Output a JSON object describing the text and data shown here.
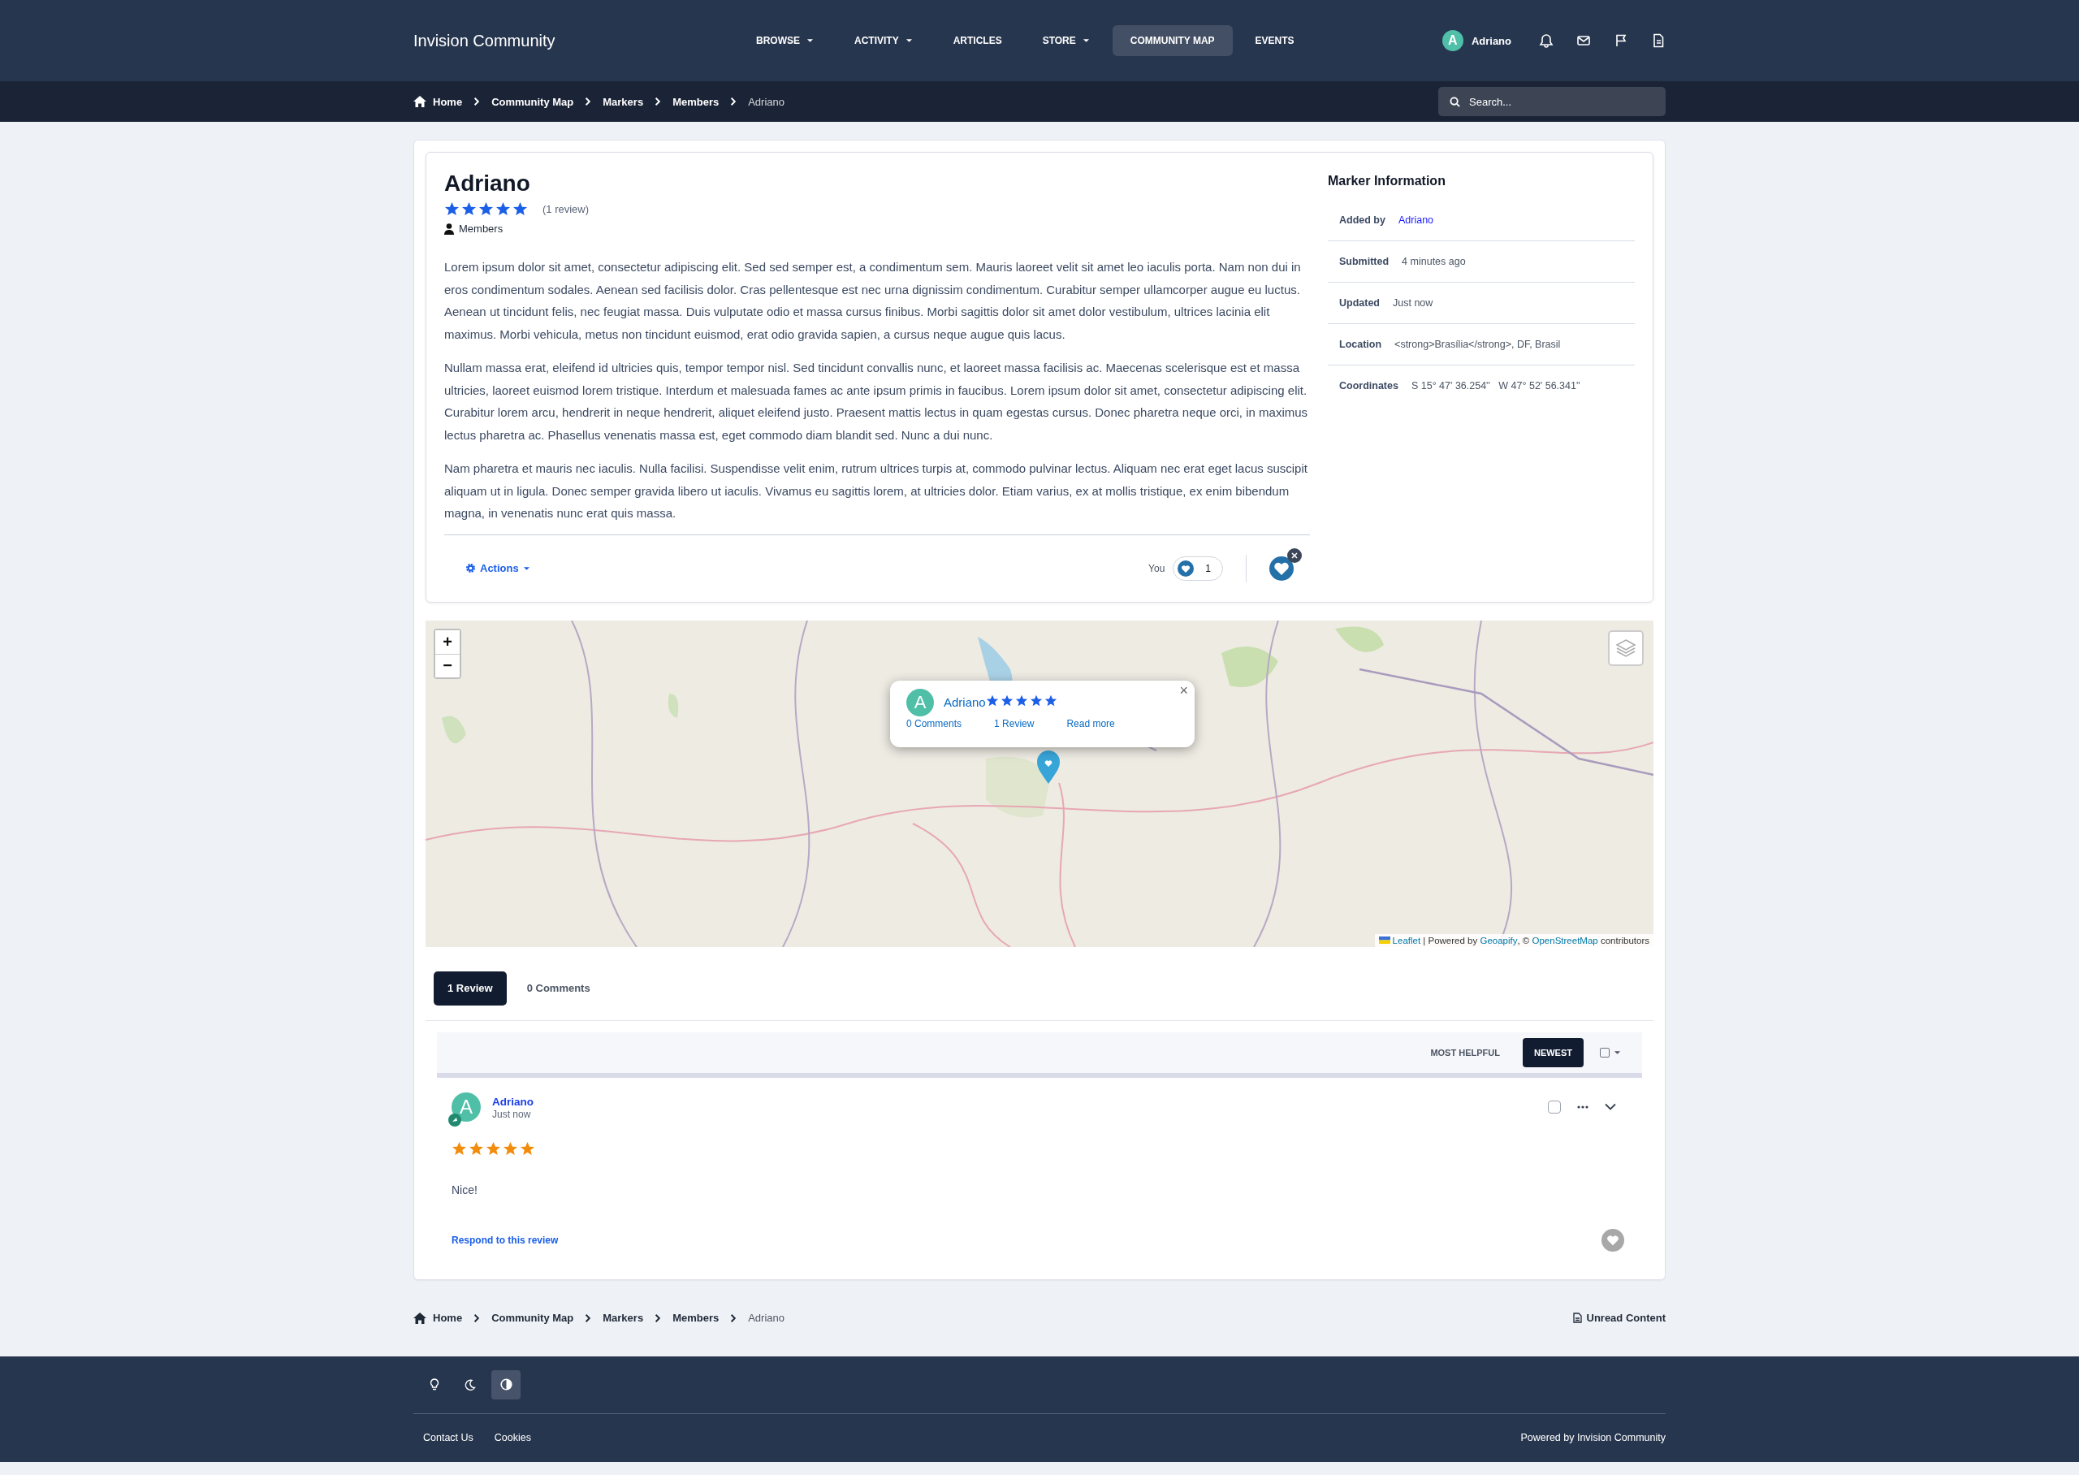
{
  "header": {
    "site_title": "Invision Community",
    "nav": [
      {
        "label": "BROWSE",
        "dropdown": true,
        "selected": false
      },
      {
        "label": "ACTIVITY",
        "dropdown": true,
        "selected": false
      },
      {
        "label": "ARTICLES",
        "dropdown": false,
        "selected": false
      },
      {
        "label": "STORE",
        "dropdown": true,
        "selected": false
      },
      {
        "label": "COMMUNITY MAP",
        "dropdown": false,
        "selected": true
      },
      {
        "label": "EVENTS",
        "dropdown": false,
        "selected": false
      }
    ],
    "user": {
      "avatar_letter": "A",
      "name": "Adriano"
    }
  },
  "breadcrumb": [
    "Home",
    "Community Map",
    "Markers",
    "Members",
    "Adriano"
  ],
  "search": {
    "placeholder": "Search..."
  },
  "marker": {
    "title": "Adriano",
    "stars": 5,
    "review_count": "(1 review)",
    "category": "Members",
    "paragraphs": [
      "Lorem ipsum dolor sit amet, consectetur adipiscing elit. Sed sed semper est, a condimentum sem. Mauris laoreet velit sit amet leo iaculis porta. Nam non dui in eros condimentum sodales. Aenean sed facilisis dolor. Cras pellentesque est nec urna dignissim condimentum. Curabitur semper ullamcorper augue eu luctus. Aenean ut tincidunt felis, nec feugiat massa. Duis vulputate odio et massa cursus finibus. Morbi sagittis dolor sit amet dolor vestibulum, ultrices lacinia elit maximus. Morbi vehicula, metus non tincidunt euismod, erat odio gravida sapien, a cursus neque augue quis lacus.",
      "Nullam massa erat, eleifend id ultricies quis, tempor tempor nisl. Sed tincidunt convallis nunc, et laoreet massa facilisis ac. Maecenas scelerisque est et massa ultricies, laoreet euismod lorem tristique. Interdum et malesuada fames ac ante ipsum primis in faucibus. Lorem ipsum dolor sit amet, consectetur adipiscing elit. Curabitur lorem arcu, hendrerit in neque hendrerit, aliquet eleifend justo. Praesent mattis lectus in quam egestas cursus. Donec pharetra neque orci, in maximus lectus pharetra ac. Phasellus venenatis massa est, eget commodo diam blandit sed. Nunc a dui nunc.",
      "Nam pharetra et mauris nec iaculis. Nulla facilisi. Suspendisse velit enim, rutrum ultrices turpis at, commodo pulvinar lectus. Aliquam nec erat eget lacus suscipit aliquam ut in ligula. Donec semper gravida libero ut iaculis. Vivamus eu sagittis lorem, at ultricies dolor. Etiam varius, ex at mollis tristique, ex enim bibendum magna, in venenatis nunc erat quis massa."
    ],
    "actions": "Actions",
    "reaction_user": "You",
    "reaction_count": "1"
  },
  "marker_info": {
    "title": "Marker Information",
    "rows": [
      {
        "label": "Added by",
        "value": "Adriano",
        "kind": "link"
      },
      {
        "label": "Submitted",
        "value": "4 minutes ago",
        "kind": "text"
      },
      {
        "label": "Updated",
        "value": "Just now",
        "kind": "text"
      },
      {
        "label": "Location",
        "value": "<strong>Brasília</strong>, DF, Brasil",
        "kind": "text"
      },
      {
        "label": "Coordinates",
        "value": "S 15° 47' 36.254''   W 47° 52' 56.341''",
        "kind": "text"
      }
    ]
  },
  "map": {
    "zoom_in": "+",
    "zoom_out": "−",
    "popup": {
      "avatar_letter": "A",
      "name": "Adriano",
      "stars": 5,
      "close": "×",
      "links": [
        "0 Comments",
        "1 Review",
        "Read more"
      ]
    },
    "attribution": [
      {
        "text": "Leaflet",
        "link": true
      },
      {
        "text": " | Powered by ",
        "link": false
      },
      {
        "text": "Geoapify",
        "link": true
      },
      {
        "text": ", © ",
        "link": false
      },
      {
        "text": "OpenStreetMap",
        "link": true
      },
      {
        "text": " contributors",
        "link": false
      }
    ]
  },
  "tabs": [
    {
      "label": "1 Review",
      "selected": true
    },
    {
      "label": "0 Comments",
      "selected": false
    }
  ],
  "sort": [
    {
      "label": "MOST HELPFUL",
      "selected": false
    },
    {
      "label": "NEWEST",
      "selected": true
    }
  ],
  "review": {
    "checked": false,
    "avatar_letter": "A",
    "author": "Adriano",
    "time": "Just now",
    "stars": 5,
    "text": "Nice!",
    "respond": "Respond to this review"
  },
  "footer_breadcrumb": [
    "Home",
    "Community Map",
    "Markers",
    "Members",
    "Adriano"
  ],
  "unread": "Unread Content",
  "themes": [
    {
      "kind": "light",
      "selected": false
    },
    {
      "kind": "dark",
      "selected": false
    },
    {
      "kind": "system",
      "selected": true
    }
  ],
  "footer_links": [
    "Contact Us",
    "Cookies"
  ],
  "powered": "Powered by Invision Community"
}
